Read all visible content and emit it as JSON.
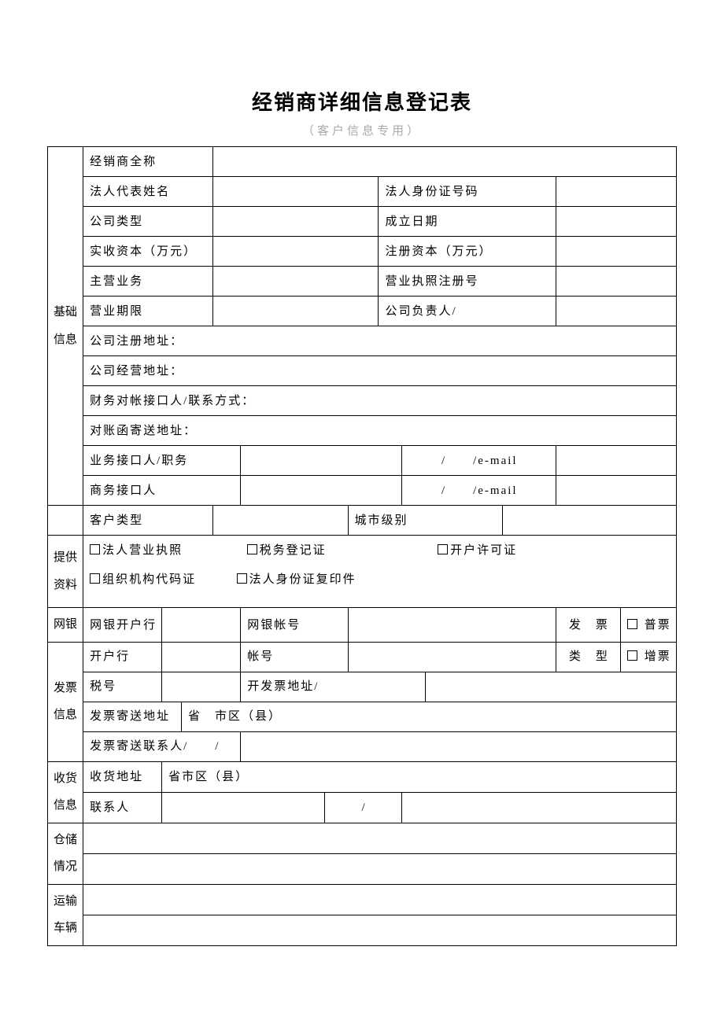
{
  "title": "经销商详细信息登记表",
  "subtitle": "（客户信息专用）",
  "sec": {
    "basic": "基础信息",
    "docs": "提供资料",
    "ebank": "网银",
    "invoice": "发票信息",
    "ship": "收货信息",
    "storage": "仓储情况",
    "transport": "运输车辆"
  },
  "lbl": {
    "dealer_full": "经销商全称",
    "legal_rep": "法人代表姓名",
    "legal_id": "法人身份证号码",
    "company_type": "公司类型",
    "found_date": "成立日期",
    "paid_cap": "实收资本（万元）",
    "reg_cap": "注册资本（万元）",
    "main_biz": "主营业务",
    "license_no": "营业执照注册号",
    "biz_term": "营业期限",
    "head": "公司负责人/",
    "reg_addr": "公司注册地址：",
    "op_addr": "公司经营地址：",
    "fin_contact": "财务对帐接口人/联系方式：",
    "stmt_addr": "对账函寄送地址：",
    "biz_contact": "业务接口人/职务",
    "com_contact": "商务接口人",
    "email": "/　　/e-mail",
    "cust_type": "客户类型",
    "city_level": "城市级别",
    "doc_license": "法人营业执照",
    "doc_tax": "税务登记证",
    "doc_permit": "开户许可证",
    "doc_org": "组织机构代码证",
    "doc_idcopy": "法人身份证复印件",
    "ebank_open": "网银开户行",
    "ebank_acct": "网银帐号",
    "inv_cat": "发票类型",
    "inv_cat_a": "发　票",
    "inv_cat_b": "类　型",
    "inv_normal": "普票",
    "inv_vat": "增票",
    "bank": "开户行",
    "acct": "帐号",
    "tax_no": "税号",
    "inv_addr": "开发票地址/",
    "inv_mail_addr": "发票寄送地址",
    "prov_city": "省　市区（县）",
    "prov_city2": "省市区（县）",
    "inv_mail_contact": "发票寄送联系人/　　/",
    "ship_addr": "收货地址",
    "contact": "联系人",
    "slash": "/"
  }
}
